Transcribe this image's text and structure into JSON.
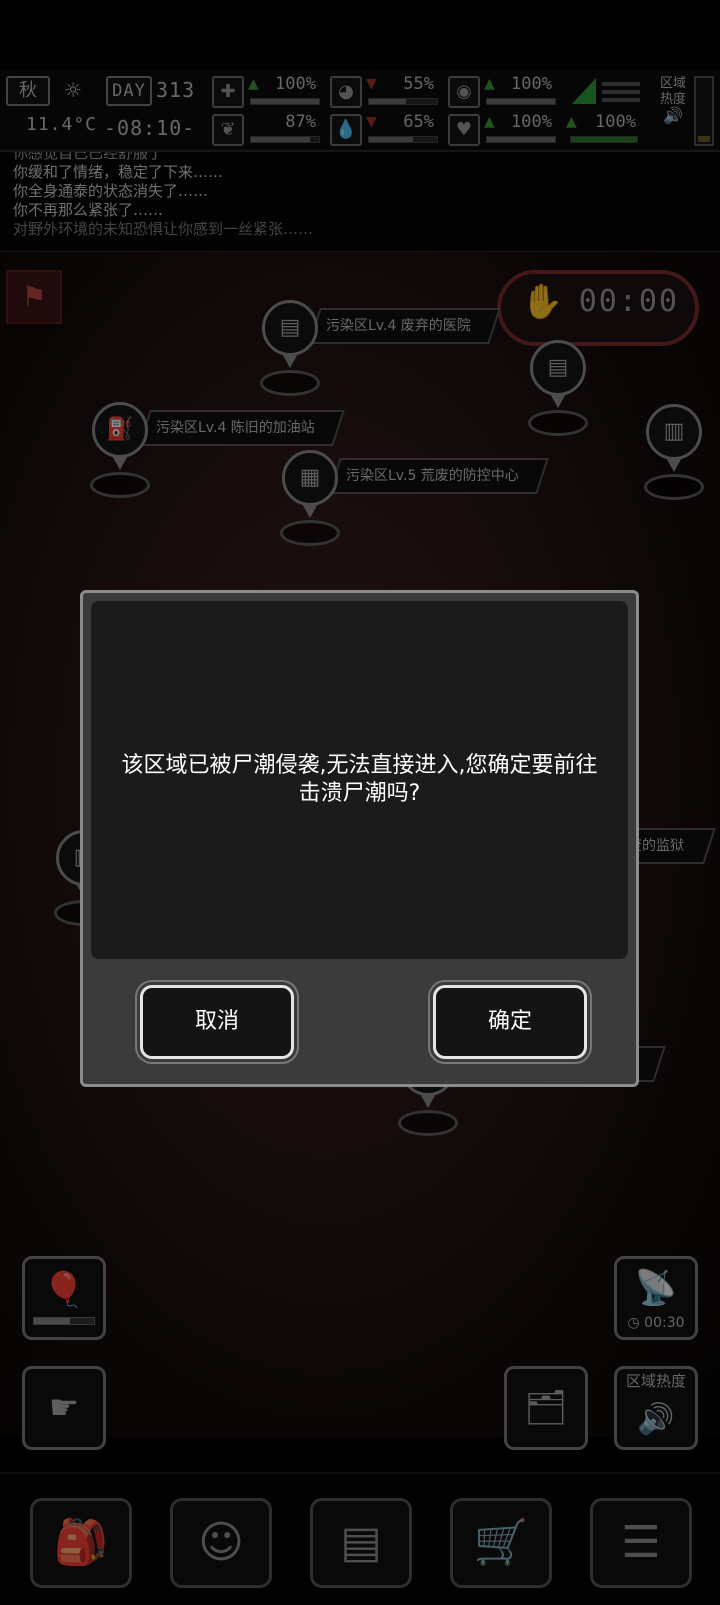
{
  "status": {
    "season": "秋",
    "day_label": "DAY",
    "day_value": "313",
    "temperature": "11.4°C",
    "time": "-08:10-",
    "health_pct": "100%",
    "hunger_pct": "55%",
    "stomach_pct": "100%",
    "mental_pct": "87%",
    "water_pct": "65%",
    "heart_pct": "100%",
    "signal_pct": "100%",
    "region_heat_label": "区域热度"
  },
  "log": {
    "lines": [
      "你感觉自己已经舒服了",
      "你缓和了情绪，稳定了下来……",
      "你全身通泰的状态消失了……",
      "你不再那么紧张了……",
      "对野外环境的未知恐惧让你感到一丝紧张……"
    ]
  },
  "map": {
    "timer": "00:00",
    "locations": [
      "污染区Lv.4 废弃的医院",
      "污染区Lv.4 陈旧的加油站",
      "污染区Lv.5 荒废的防控中心",
      "荒废的监狱"
    ]
  },
  "side": {
    "radar_timer": "00:30",
    "region_heat_label": "区域热度"
  },
  "dialog": {
    "message": "该区域已被尸潮侵袭,无法直接进入,您确定要前往击溃尸潮吗?",
    "cancel_label": "取消",
    "confirm_label": "确定"
  },
  "icons": {
    "bottom_nav": [
      "backpack-icon",
      "brain-icon",
      "notebook-icon",
      "cart-icon",
      "menu-icon"
    ]
  },
  "colors": {
    "dialog_bg": "#3b3b3b",
    "dialog_inner": "#1b1b1b",
    "timer_border": "#7c2c2c"
  }
}
